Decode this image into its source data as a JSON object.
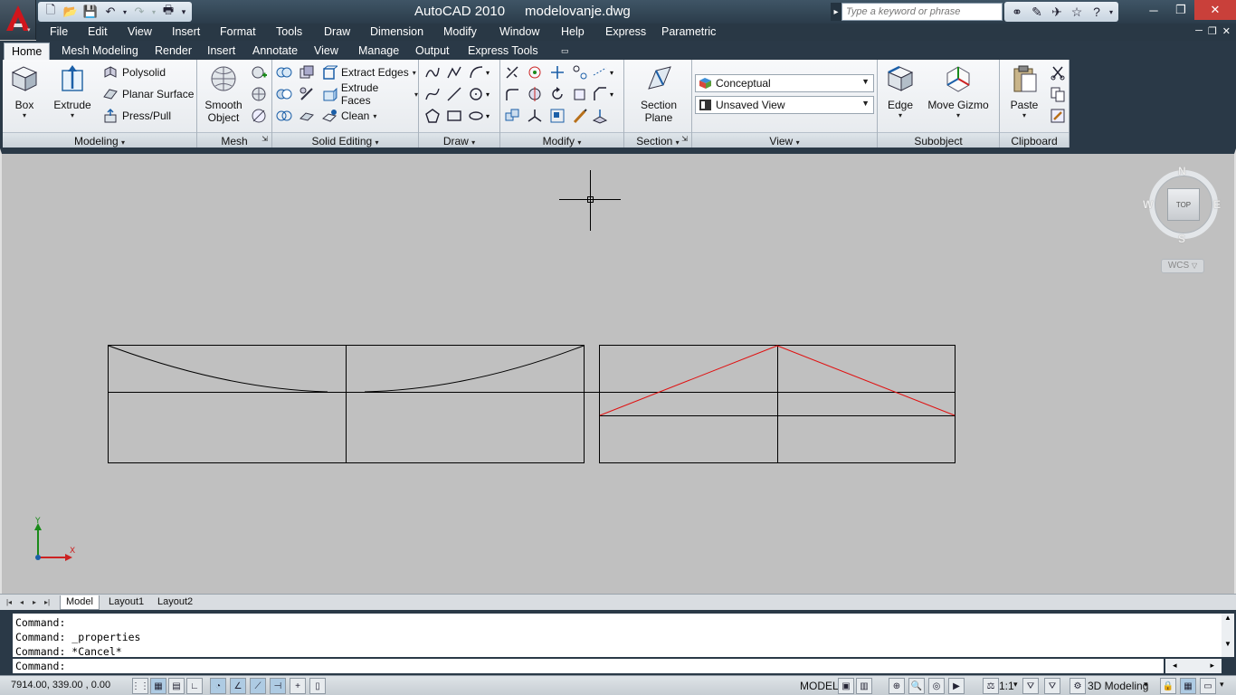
{
  "window": {
    "app_title": "AutoCAD 2010",
    "file_name": "modelovanje.dwg",
    "search_placeholder": "Type a keyword or phrase"
  },
  "menubar": {
    "items": [
      "File",
      "Edit",
      "View",
      "Insert",
      "Format",
      "Tools",
      "Draw",
      "Dimension",
      "Modify",
      "Window",
      "Help",
      "Express",
      "Parametric"
    ]
  },
  "ribbon": {
    "tabs": [
      "Home",
      "Mesh Modeling",
      "Render",
      "Insert",
      "Annotate",
      "View",
      "Manage",
      "Output",
      "Express Tools"
    ],
    "active_tab": "Home",
    "modeling": {
      "title": "Modeling",
      "box": "Box",
      "extrude": "Extrude",
      "polysolid": "Polysolid",
      "planar_surface": "Planar Surface",
      "press_pull": "Press/Pull"
    },
    "mesh": {
      "title": "Mesh",
      "smooth_line1": "Smooth",
      "smooth_line2": "Object"
    },
    "solid_editing": {
      "title": "Solid Editing",
      "extract_edges": "Extract Edges",
      "extrude_faces": "Extrude Faces",
      "clean": "Clean"
    },
    "draw": {
      "title": "Draw"
    },
    "modify": {
      "title": "Modify"
    },
    "section": {
      "title": "Section",
      "plane_line1": "Section",
      "plane_line2": "Plane"
    },
    "view": {
      "title": "View",
      "visual_style": "Conceptual",
      "named_view": "Unsaved View"
    },
    "subobject": {
      "title": "Subobject",
      "edge": "Edge",
      "move_gizmo": "Move Gizmo"
    },
    "clipboard": {
      "title": "Clipboard",
      "paste": "Paste"
    }
  },
  "viewcube": {
    "face": "TOP",
    "north": "N",
    "south": "S",
    "east": "E",
    "west": "W",
    "wcs": "WCS"
  },
  "ucs": {
    "x": "X",
    "y": "Y"
  },
  "layout_tabs": [
    "Model",
    "Layout1",
    "Layout2"
  ],
  "command": {
    "history": [
      "Command:",
      "Command: _properties",
      "Command: *Cancel*"
    ],
    "prompt": "Command:"
  },
  "statusbar": {
    "coords": "7914.00, 339.00 , 0.00",
    "model": "MODEL",
    "scale": "1:1",
    "workspace": "3D Modeling"
  },
  "colors": {
    "red_line": "#e01010",
    "canvas": "#c0c0c0"
  }
}
